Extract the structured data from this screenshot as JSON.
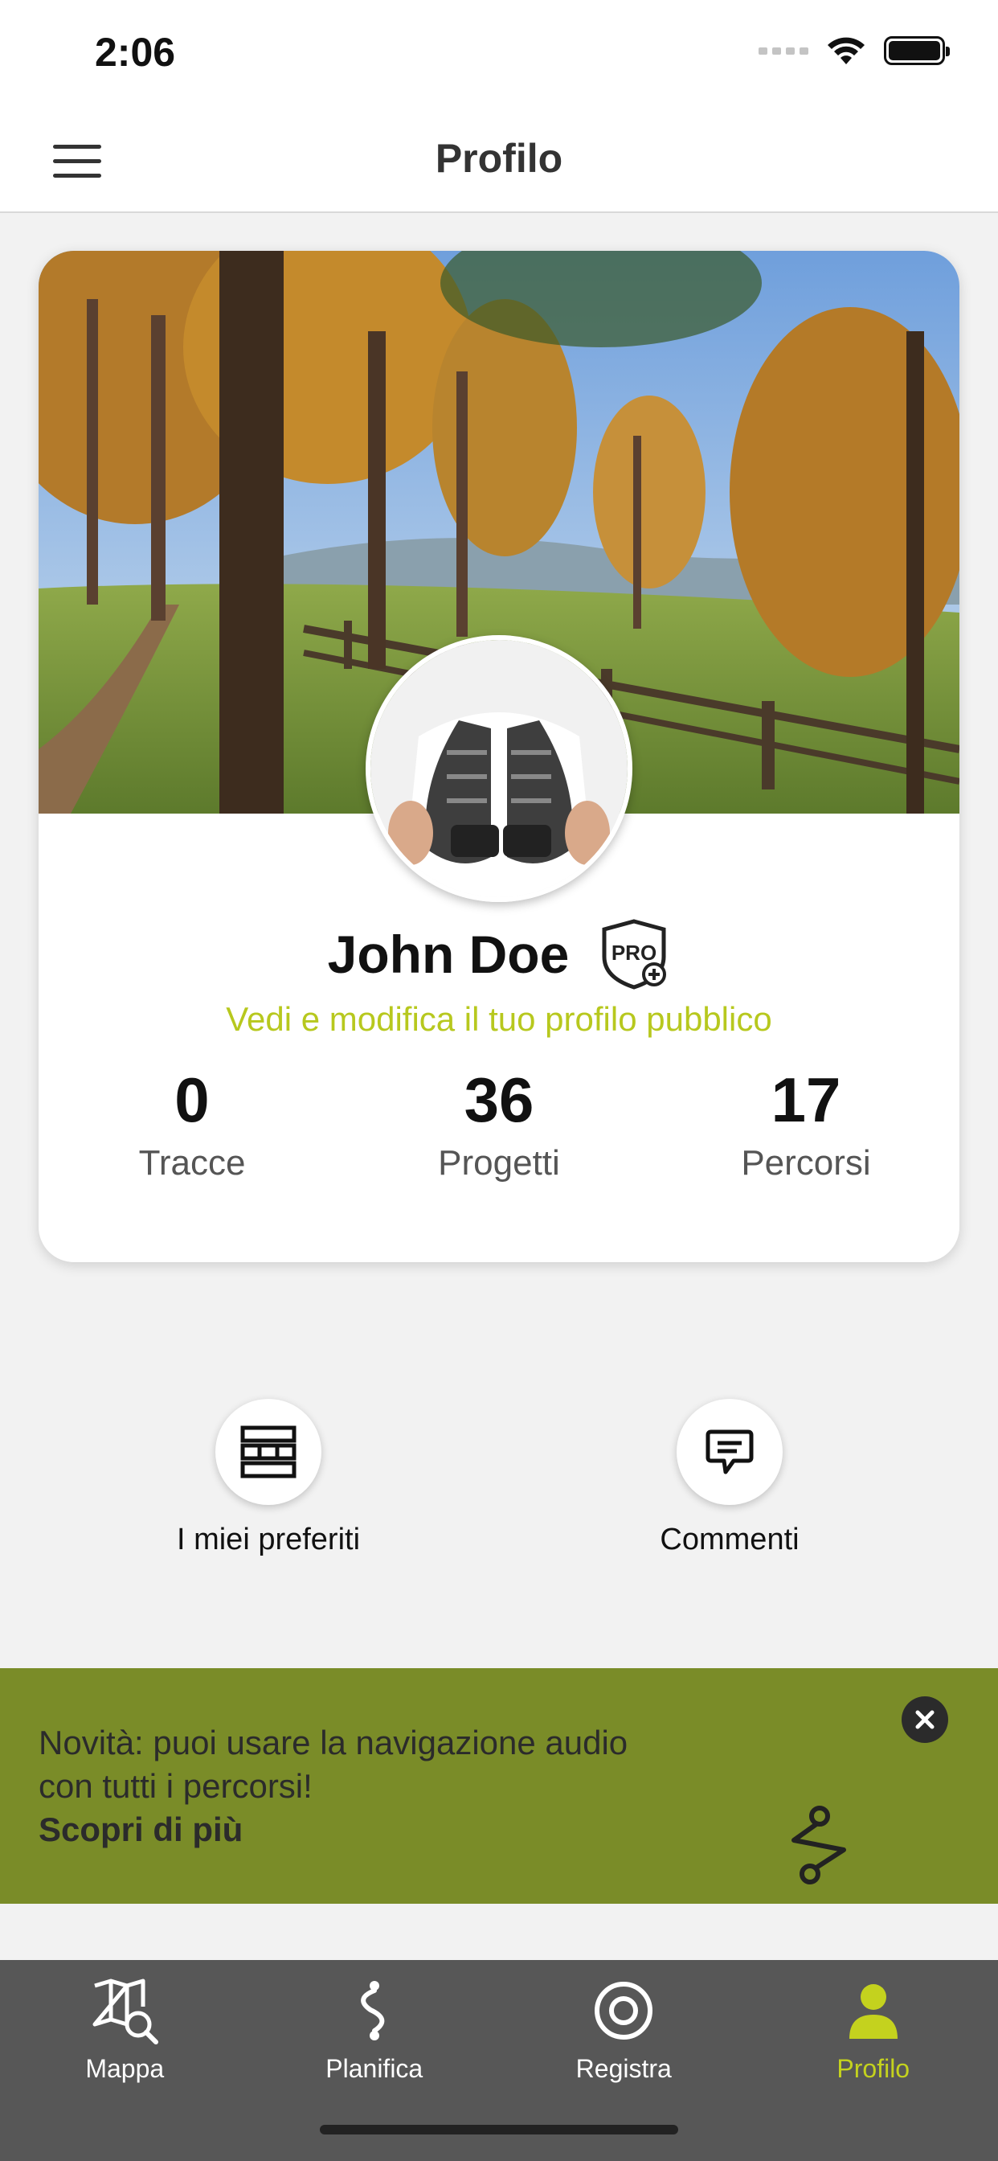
{
  "status_bar": {
    "time": "2:06"
  },
  "header": {
    "title": "Profilo"
  },
  "profile": {
    "name": "John Doe",
    "badge": "PRO",
    "edit_link": "Vedi e modifica il tuo profilo pubblico",
    "stats": [
      {
        "value": "0",
        "label": "Tracce"
      },
      {
        "value": "36",
        "label": "Progetti"
      },
      {
        "value": "17",
        "label": "Percorsi"
      }
    ]
  },
  "actions": [
    {
      "label": "I miei preferiti",
      "icon": "favorites-list-icon"
    },
    {
      "label": "Commenti",
      "icon": "comment-icon"
    }
  ],
  "banner": {
    "text_line1": "Novità: puoi usare la navigazione audio",
    "text_line2": "con tutti i percorsi!",
    "link": "Scopri di più",
    "icon": "route-icon",
    "close_icon": "close-icon"
  },
  "bottom_nav": [
    {
      "label": "Mappa",
      "icon": "map-search-icon",
      "active": false
    },
    {
      "label": "Planifica",
      "icon": "route-plan-icon",
      "active": false
    },
    {
      "label": "Registra",
      "icon": "record-icon",
      "active": false
    },
    {
      "label": "Profilo",
      "icon": "user-icon",
      "active": true
    }
  ],
  "colors": {
    "accent": "#b7c81e",
    "active_nav": "#c4d21e",
    "banner_bg": "#7a8c28",
    "nav_bg": "#575757"
  }
}
